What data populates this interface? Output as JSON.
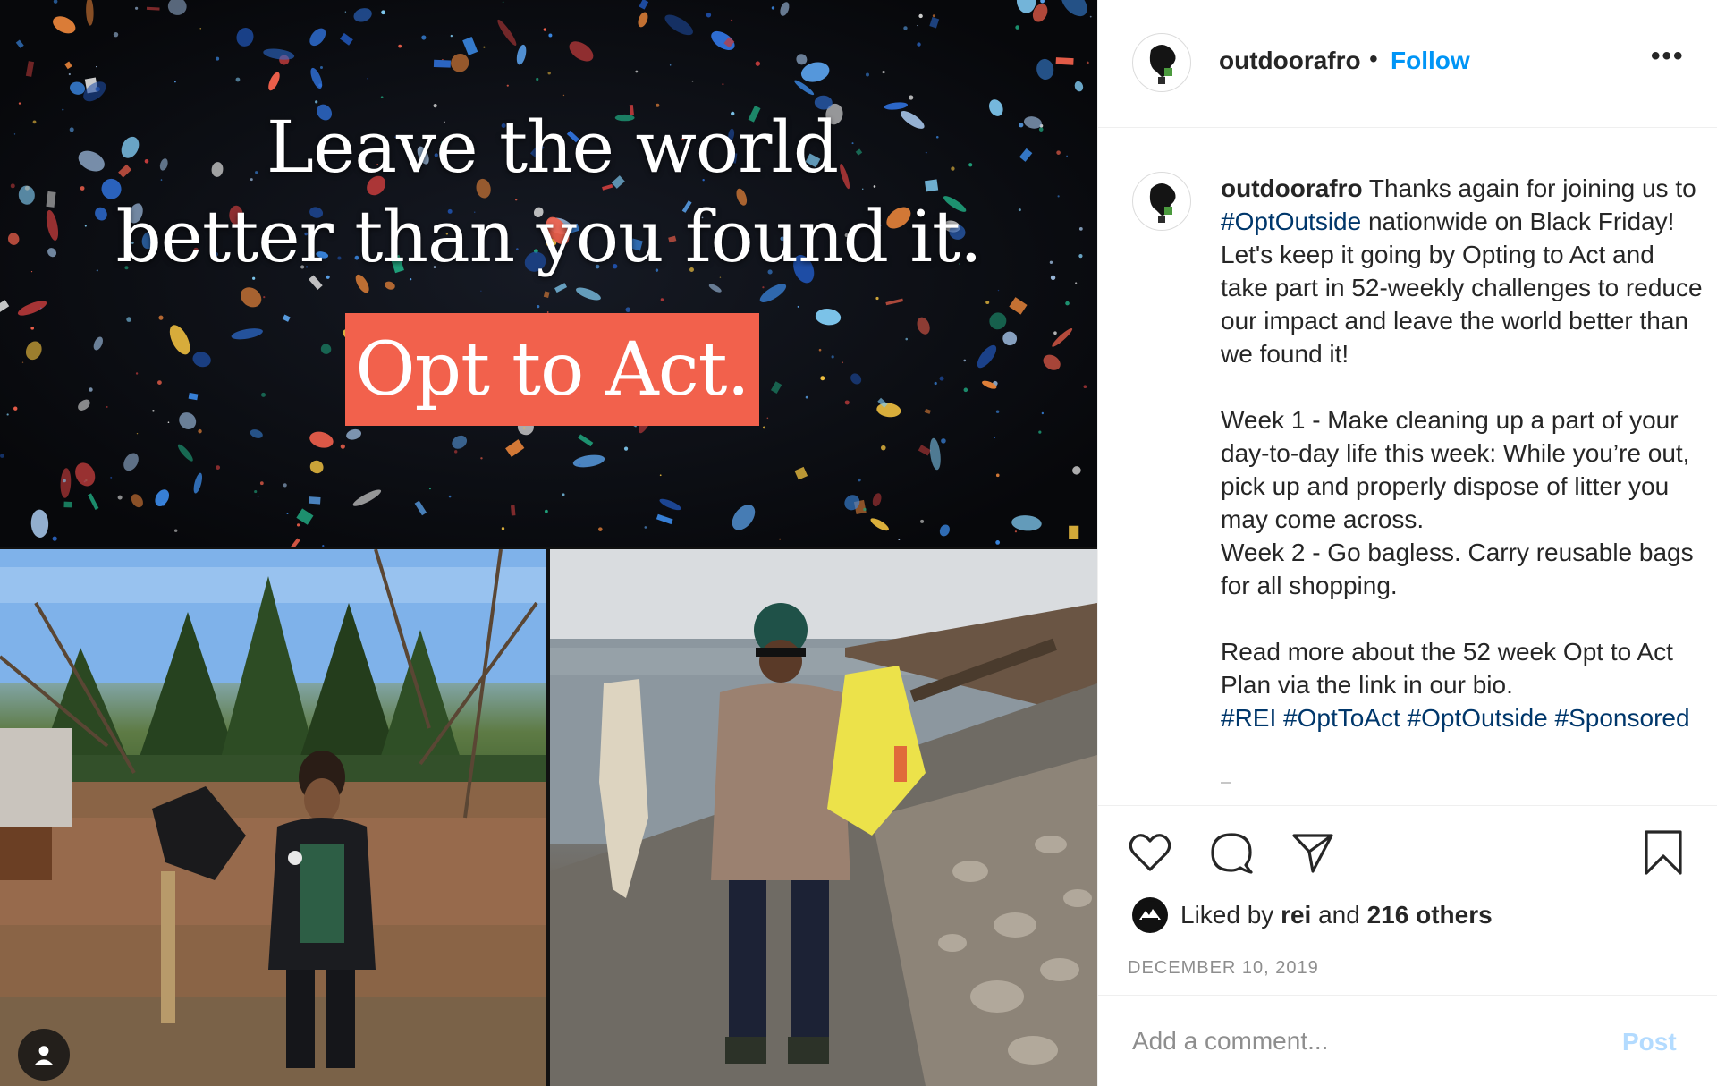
{
  "media": {
    "banner": {
      "headline_line1": "Leave the world",
      "headline_line2": "better than you found it.",
      "cta_label": "Opt to Act."
    },
    "banner_accent_color": "#f2614c"
  },
  "header": {
    "username": "outdoorafro",
    "separator": "•",
    "follow_label": "Follow",
    "more_label": "•••"
  },
  "caption": {
    "username": "outdoorafro",
    "intro_before_tag": " Thanks again for joining us to ",
    "tag_optoutside": "#OptOutside",
    "intro_after_tag": " nationwide on Black Friday! Let's keep it going by Opting to Act and take part in 52-weekly challenges to reduce our impact and leave the world better than we found it!",
    "week1": "Week 1 - Make cleaning up a part of your day-to-day life this week: While you’re out, pick up and properly dispose of litter you may come across.",
    "week2": "Week 2 - Go bagless. Carry reusable bags for all shopping.",
    "read_more": "Read more about the 52 week Opt to Act Plan via the link in our bio.",
    "hashtags": [
      "#REI",
      "#OptToAct",
      "#OptOutside",
      "#Sponsored"
    ]
  },
  "likes": {
    "prefix": "Liked by ",
    "liker": "rei",
    "joiner": " and ",
    "others": "216 others"
  },
  "date": "DECEMBER 10, 2019",
  "comment": {
    "placeholder": "Add a comment...",
    "post_label": "Post"
  },
  "icons": {
    "like": "heart-icon",
    "comment": "comment-bubble-icon",
    "share": "paper-plane-icon",
    "save": "bookmark-icon",
    "tagged_user": "user-icon"
  },
  "colors": {
    "link_blue": "#0095f6",
    "hashtag_blue": "#00376b",
    "muted_gray": "#8e8e8e",
    "post_disabled": "#b3dbff"
  }
}
